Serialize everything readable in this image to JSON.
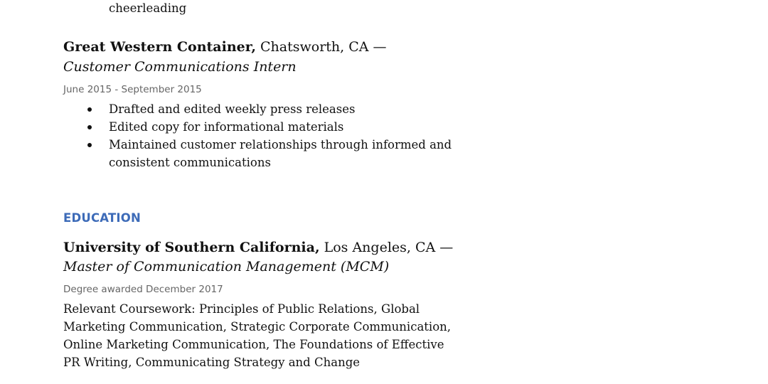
{
  "prev_entry": {
    "continued_line": "cheerleading"
  },
  "experience_entry": {
    "organization": "Great Western Container,",
    "location": " Chatsworth, CA —",
    "role": "Customer Communications Intern",
    "dates": "June 2015 - September 2015",
    "bullets": [
      "Drafted and edited weekly press releases",
      "Edited copy for informational materials",
      "Maintained customer relationships through informed and",
      "consistent communications"
    ]
  },
  "education": {
    "section_title": "EDUCATION",
    "school": "University of Southern California,",
    "location": " Los Angeles, CA —",
    "degree": "Master of Communication Management (MCM)",
    "awarded": "Degree awarded December 2017",
    "coursework_lines": [
      "Relevant Coursework: Principles of Public Relations, Global",
      "Marketing Communication, Strategic Corporate Communication,",
      "Online Marketing Communication, The Foundations of Effective",
      "PR Writing, Communicating Strategy and Change"
    ]
  }
}
